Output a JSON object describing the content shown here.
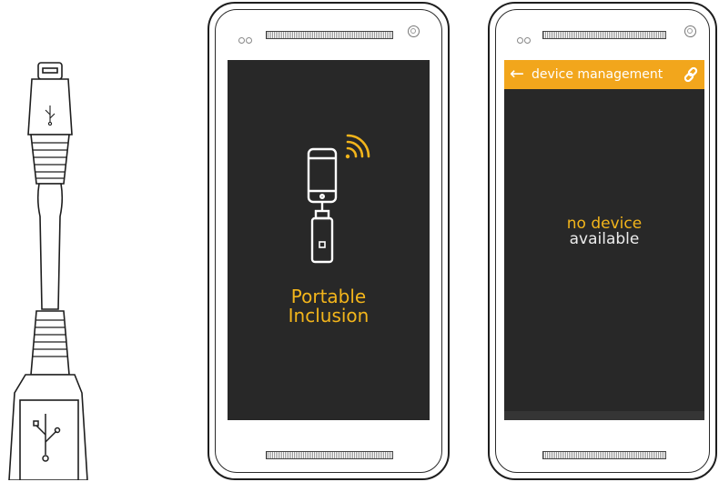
{
  "splash_screen": {
    "app_name_line1": "Portable",
    "app_name_line2": "Inclusion",
    "illustration_icon": "phone-with-usb-dongle-icon",
    "signal_icon": "wifi-signal-icon"
  },
  "device_management_screen": {
    "title": "device management",
    "back_icon": "back-arrow-icon",
    "action_icon": "link-icon",
    "empty_message_line1": "no device",
    "empty_message_line2": "available"
  },
  "illustrations": {
    "usb_adapter": "micro-usb-to-usb-adapter-cable"
  },
  "colors": {
    "accent": "#f2a61c",
    "screen_background": "#282828",
    "accent_text": "#f3b51b"
  }
}
